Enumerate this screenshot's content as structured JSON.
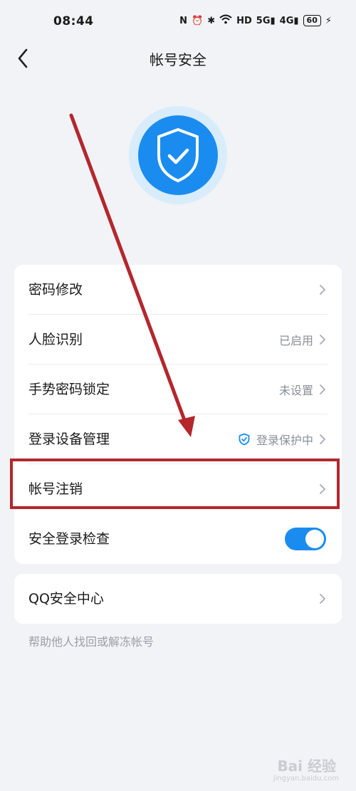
{
  "status_bar": {
    "time": "08:44",
    "battery": "60"
  },
  "header": {
    "title": "帐号安全"
  },
  "settings": {
    "rows": [
      {
        "label": "密码修改",
        "status": ""
      },
      {
        "label": "人脸识别",
        "status": "已启用"
      },
      {
        "label": "手势密码锁定",
        "status": "未设置"
      },
      {
        "label": "登录设备管理",
        "status": "登录保护中"
      },
      {
        "label": "帐号注销",
        "status": ""
      },
      {
        "label": "安全登录检查",
        "toggle": true
      }
    ]
  },
  "security_center": {
    "label": "QQ安全中心"
  },
  "help_text": "帮助他人找回或解冻帐号",
  "watermark": {
    "text": "Bai 经验",
    "sub": "jingyan.baidu.com"
  },
  "colors": {
    "accent": "#1a8cf0",
    "highlight": "#b3272d",
    "background": "#f1f3f6"
  }
}
